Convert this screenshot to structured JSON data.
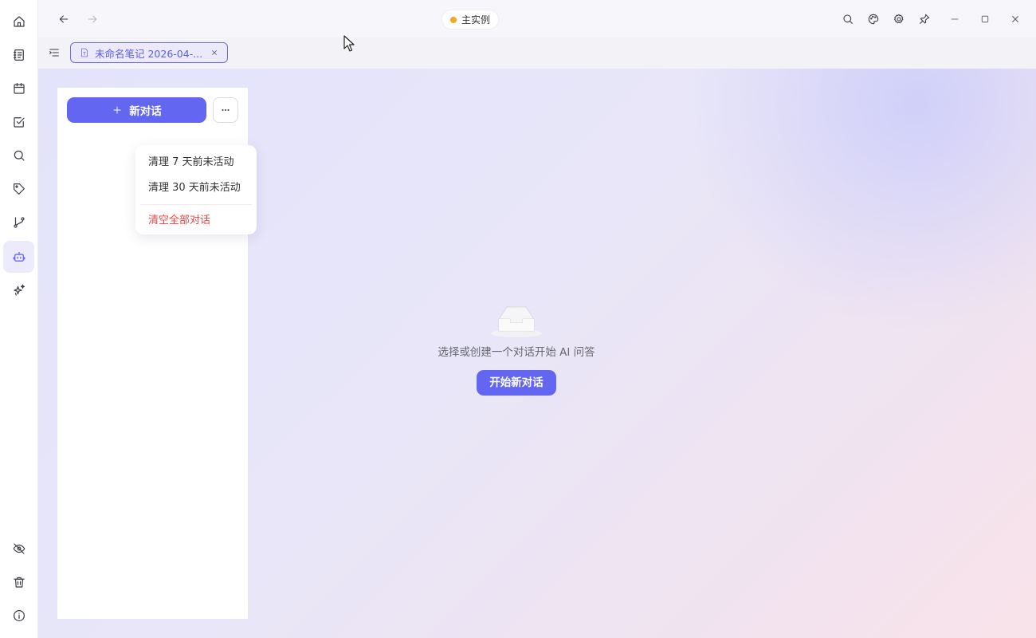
{
  "rail": {
    "top_items": [
      {
        "name": "home-icon"
      },
      {
        "name": "notebook-icon"
      },
      {
        "name": "calendar-icon"
      },
      {
        "name": "task-checkbox-icon"
      },
      {
        "name": "search-icon"
      },
      {
        "name": "tag-icon"
      },
      {
        "name": "git-branch-icon"
      },
      {
        "name": "robot-icon",
        "active": true
      },
      {
        "name": "sparkles-icon"
      }
    ],
    "bottom_items": [
      {
        "name": "eye-off-icon"
      },
      {
        "name": "trash-icon"
      },
      {
        "name": "info-icon"
      }
    ]
  },
  "titlebar": {
    "instance_label": "主实例",
    "instance_color": "#f5a623"
  },
  "tabs": [
    {
      "label": "未命名笔记 2026-04-...",
      "active": true
    }
  ],
  "conversations": {
    "new_button_label": "新对话",
    "menu": {
      "items": [
        "清理 7 天前未活动",
        "清理 30 天前未活动"
      ],
      "danger_item": "清空全部对话"
    }
  },
  "empty_state": {
    "message": "选择或创建一个对话开始 AI 问答",
    "button_label": "开始新对话"
  },
  "colors": {
    "accent": "#6366f1",
    "danger": "#ef4444"
  }
}
